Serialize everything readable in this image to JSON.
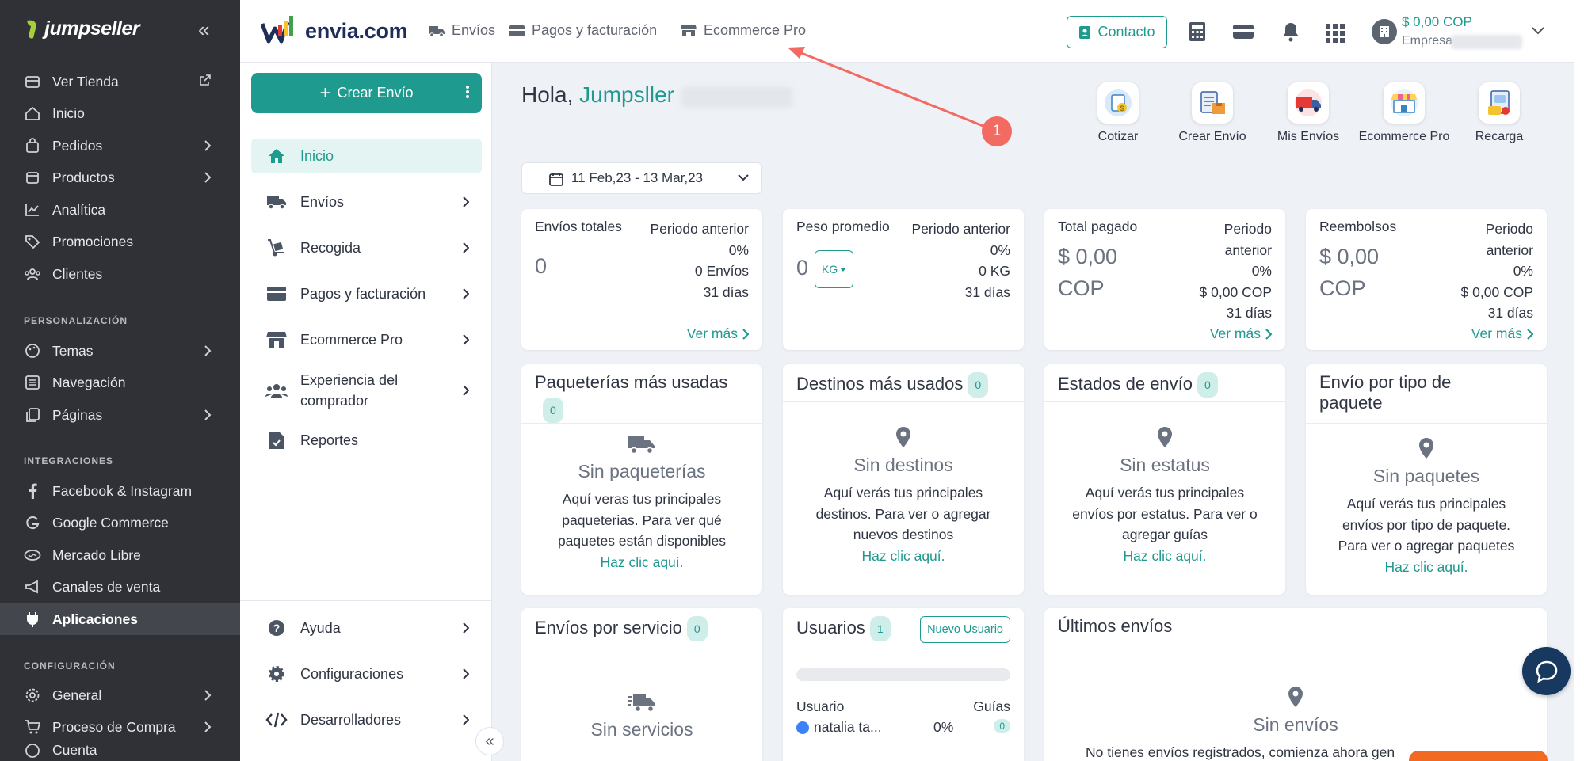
{
  "jumpseller": {
    "brand": "jumpseller",
    "items": [
      {
        "label": "Ver Tienda",
        "icon": "store-icon"
      },
      {
        "label": "Inicio",
        "icon": "home-icon"
      },
      {
        "label": "Pedidos",
        "icon": "bag-icon"
      },
      {
        "label": "Productos",
        "icon": "box-icon"
      },
      {
        "label": "Analítica",
        "icon": "chart-icon"
      },
      {
        "label": "Promociones",
        "icon": "tag-icon"
      },
      {
        "label": "Clientes",
        "icon": "users-icon"
      }
    ],
    "section_personalizacion": "PERSONALIZACIÓN",
    "personalizacion": [
      {
        "label": "Temas",
        "icon": "palette-icon"
      },
      {
        "label": "Navegación",
        "icon": "list-icon"
      },
      {
        "label": "Páginas",
        "icon": "pages-icon"
      }
    ],
    "section_integraciones": "INTEGRACIONES",
    "integraciones": [
      {
        "label": "Facebook & Instagram",
        "icon": "facebook-icon"
      },
      {
        "label": "Google Commerce",
        "icon": "google-icon"
      },
      {
        "label": "Mercado Libre",
        "icon": "handshake-icon"
      },
      {
        "label": "Canales de venta",
        "icon": "megaphone-icon"
      },
      {
        "label": "Aplicaciones",
        "icon": "plug-icon"
      }
    ],
    "section_configuracion": "CONFIGURACIÓN",
    "configuracion": [
      {
        "label": "General",
        "icon": "gear-icon"
      },
      {
        "label": "Proceso de Compra",
        "icon": "cart-icon"
      },
      {
        "label": "Cuenta",
        "icon": "account-icon"
      }
    ]
  },
  "topbar": {
    "logo": "envia.com",
    "nav": [
      {
        "label": "Envíos",
        "icon": "truck-icon"
      },
      {
        "label": "Pagos y facturación",
        "icon": "card-icon"
      },
      {
        "label": "Ecommerce Pro",
        "icon": "store-icon"
      }
    ],
    "contact": "Contacto",
    "balance": "$ 0,00 COP",
    "company": "Empresa"
  },
  "envia_side": {
    "create": "Crear Envío",
    "items": [
      {
        "label": "Inicio",
        "icon": "home-icon"
      },
      {
        "label": "Envíos",
        "icon": "truck-icon"
      },
      {
        "label": "Recogida",
        "icon": "dolly-icon"
      },
      {
        "label": "Pagos y facturación",
        "icon": "card-icon"
      },
      {
        "label": "Ecommerce Pro",
        "icon": "store-icon"
      },
      {
        "label": "Experiencia del comprador",
        "icon": "users-icon"
      },
      {
        "label": "Reportes",
        "icon": "report-icon"
      }
    ],
    "bottom": [
      {
        "label": "Ayuda",
        "icon": "help-icon"
      },
      {
        "label": "Configuraciones",
        "icon": "gear-icon"
      },
      {
        "label": "Desarrolladores",
        "icon": "code-icon"
      }
    ]
  },
  "main": {
    "greeting": "Hola,",
    "user": "Jumpsller",
    "quick_actions": [
      {
        "label": "Cotizar",
        "icon": "quote-icon"
      },
      {
        "label": "Crear Envío",
        "icon": "create-shipment-icon"
      },
      {
        "label": "Mis Envíos",
        "icon": "my-shipments-icon"
      },
      {
        "label": "Ecommerce Pro",
        "icon": "ecommerce-icon"
      },
      {
        "label": "Recarga",
        "icon": "recharge-icon"
      }
    ],
    "date_range": "11 Feb,23 - 13 Mar,23",
    "annotation_marker": "1",
    "stats": [
      {
        "label": "Envíos totales",
        "prev": [
          "Periodo anterior",
          "0%",
          "0 Envíos",
          "31 días"
        ],
        "value": "0",
        "more": "Ver más"
      },
      {
        "label": "Peso promedio",
        "prev": [
          "Periodo anterior",
          "0%",
          "0 KG",
          "31 días"
        ],
        "value": "0",
        "unit": "KG",
        "more": ""
      },
      {
        "label": "Total pagado",
        "prev": [
          "Periodo",
          "anterior",
          "0%",
          "$ 0,00 COP",
          "31 días"
        ],
        "value_1": "$ 0,00",
        "value_2": "COP",
        "more": "Ver más"
      },
      {
        "label": "Reembolsos",
        "prev": [
          "Periodo",
          "anterior",
          "0%",
          "$ 0,00 COP",
          "31 días"
        ],
        "value_1": "$ 0,00",
        "value_2": "COP",
        "more": "Ver más"
      }
    ],
    "widgets": [
      {
        "title": "Paqueterías más usadas",
        "count": "0",
        "empty_title": "Sin paqueterías",
        "empty_text": [
          "Aquí veras tus principales",
          "paqueterias. Para ver qué",
          "paquetes están disponibles"
        ],
        "link": "Haz clic aquí."
      },
      {
        "title": "Destinos más usados",
        "count": "0",
        "empty_title": "Sin destinos",
        "empty_text": [
          "Aquí verás tus principales",
          "destinos. Para ver o agregar",
          "nuevos destinos"
        ],
        "link": "Haz clic aquí."
      },
      {
        "title": "Estados de envío",
        "count": "0",
        "empty_title": "Sin estatus",
        "empty_text": [
          "Aquí verás tus principales",
          "envíos por estatus. Para ver o",
          "agregar guías"
        ],
        "link": "Haz clic aquí."
      },
      {
        "title_1": "Envío por tipo de",
        "title_2": "paquete",
        "empty_title": "Sin paquetes",
        "empty_text": [
          "Aquí verás tus principales",
          "envíos por tipo de paquete.",
          "Para ver o agregar paquetes"
        ],
        "link": "Haz clic aquí."
      }
    ],
    "services": {
      "title": "Envíos por servicio",
      "count": "0",
      "empty_title": "Sin servicios"
    },
    "users": {
      "title": "Usuarios",
      "count": "1",
      "new_user": "Nuevo Usuario",
      "col_user": "Usuario",
      "col_guides": "Guías",
      "row_name": "natalia ta...",
      "row_pct": "0%",
      "row_count": "0"
    },
    "last": {
      "title": "Últimos envíos",
      "empty_title": "Sin envíos",
      "empty_text": "No tienes envíos registrados, comienza ahora gen"
    }
  }
}
